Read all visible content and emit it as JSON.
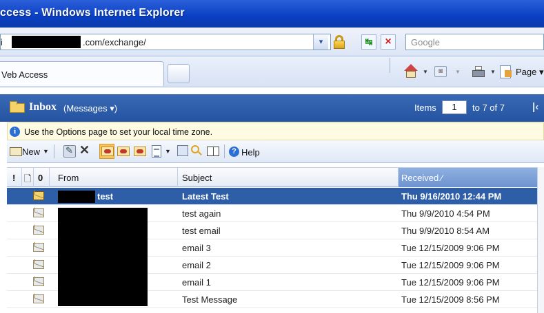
{
  "window": {
    "title": "ccess - Windows Internet Explorer"
  },
  "address_bar": {
    "prefix": "i",
    "url_visible": ".com/exchange/",
    "dropdown": "▾",
    "search_placeholder": "Google"
  },
  "tabs": {
    "active_label": "Veb Access"
  },
  "command_bar": {
    "page_label": "Page ▾",
    "feed_glyph": "◙"
  },
  "owa": {
    "folder": "Inbox",
    "view_selector": "(Messages ▾)",
    "items_label": "Items",
    "items_page": "1",
    "items_range": "to 7 of 7",
    "first_page_glyph": "|‹"
  },
  "info_bar": {
    "text": "Use the Options page to set your local time zone.",
    "icon_glyph": "i"
  },
  "toolbar": {
    "new_label": "New",
    "help_label": "Help",
    "delete_glyph": "✕",
    "help_glyph": "?"
  },
  "columns": {
    "importance": "!",
    "type": "🗋",
    "attachment": "0",
    "from": "From",
    "subject": "Subject",
    "received": "Received ⁄"
  },
  "messages": [
    {
      "from": "test",
      "subject": "Latest Test",
      "received": "Thu 9/16/2010 12:44 PM",
      "selected": true,
      "read": false
    },
    {
      "from": "",
      "subject": "test again",
      "received": "Thu 9/9/2010 4:54 PM",
      "selected": false,
      "read": true
    },
    {
      "from": "",
      "subject": "test email",
      "received": "Thu 9/9/2010 8:54 AM",
      "selected": false,
      "read": true
    },
    {
      "from": "",
      "subject": "email 3",
      "received": "Tue 12/15/2009 9:06 PM",
      "selected": false,
      "read": true
    },
    {
      "from": "",
      "subject": "email 2",
      "received": "Tue 12/15/2009 9:06 PM",
      "selected": false,
      "read": true
    },
    {
      "from": "",
      "subject": "email 1",
      "received": "Tue 12/15/2009 9:06 PM",
      "selected": false,
      "read": true
    },
    {
      "from": "",
      "subject": "Test Message",
      "received": "Tue 12/15/2009 8:56 PM",
      "selected": false,
      "read": true
    }
  ],
  "colors": {
    "title_bar": "#0a3fc4",
    "owa_header": "#2453a1",
    "selected_row": "#2e5ea8",
    "info_bar": "#fffbe3"
  }
}
